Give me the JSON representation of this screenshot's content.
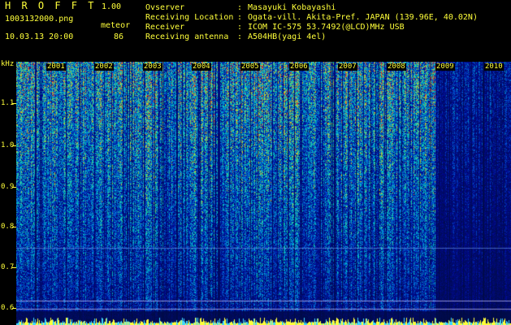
{
  "app": {
    "title": "H R O F F T",
    "version": "1.00"
  },
  "file": {
    "name": "1003132000.png",
    "datetime": "10.03.13 20:00"
  },
  "meteor": {
    "label": "meteor",
    "count": "86"
  },
  "info": [
    {
      "key": "Ovserver",
      "value": "Masayuki Kobayashi"
    },
    {
      "key": "Receiving Location",
      "value": "Ogata-vill. Akita-Pref. JAPAN (139.96E, 40.02N)"
    },
    {
      "key": "Receiver",
      "value": "ICOM IC-575 53.7492(@LCD)MHz USB"
    },
    {
      "key": "Receiving antenna",
      "value": "A504HB(yagi 4el)"
    }
  ],
  "axis": {
    "unit": "kHz",
    "ticks": [
      "1.1",
      "1.0",
      "0.9",
      "0.8",
      "0.7",
      "0.6"
    ],
    "years": [
      "2001",
      "2002",
      "2003",
      "2004",
      "2005",
      "2006",
      "2007",
      "2008",
      "2009",
      "2010"
    ]
  },
  "colors": {
    "text": "#ffff3a",
    "background": "#000000"
  }
}
